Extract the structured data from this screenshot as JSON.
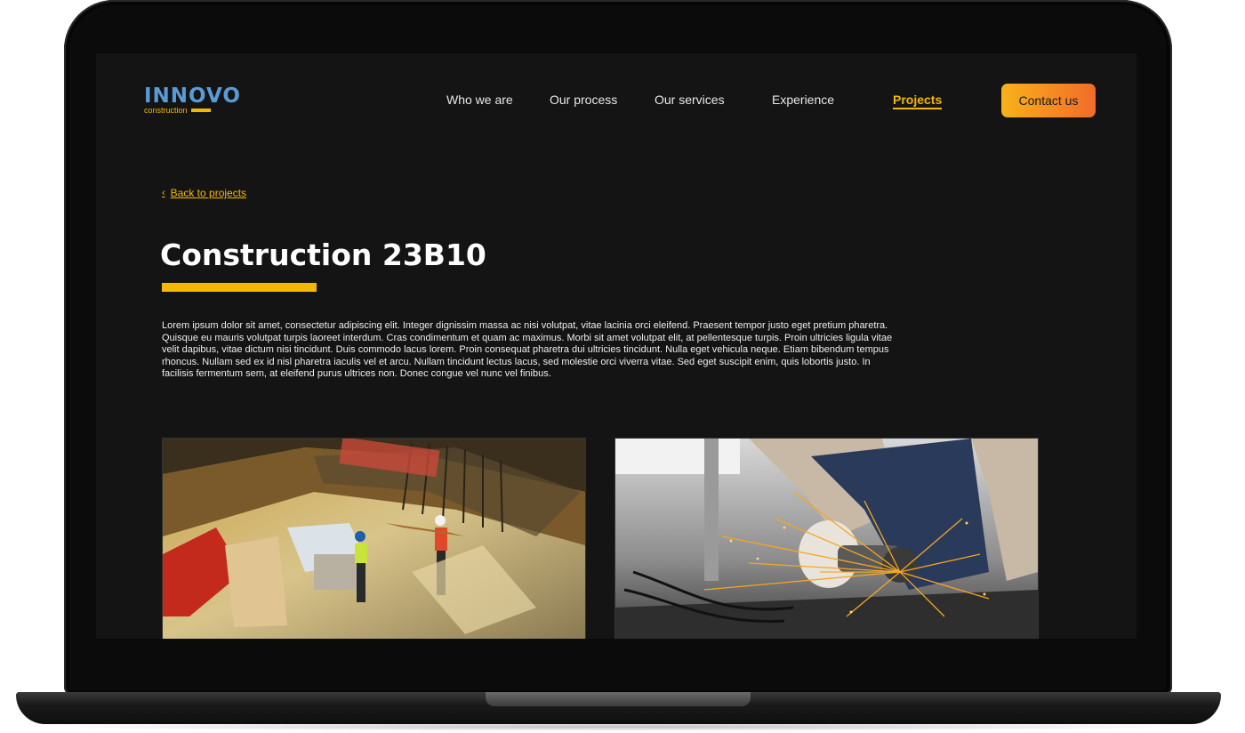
{
  "brand": {
    "name": "INNOVO",
    "tagline": "construction",
    "accent_color": "#f5b800",
    "logo_color": "#5b9bd5"
  },
  "nav": {
    "items": [
      {
        "label": "Who we are"
      },
      {
        "label": "Our process"
      },
      {
        "label": "Our services"
      },
      {
        "label": "Experience"
      },
      {
        "label": "Projects",
        "active": true
      }
    ],
    "cta_label": "Contact us"
  },
  "page": {
    "back_label": "Back to projects",
    "title": "Construction 23B10",
    "description": "Lorem ipsum dolor sit amet, consectetur adipiscing elit. Integer dignissim massa ac nisi volutpat, vitae lacinia orci eleifend. Praesent tempor justo eget pretium pharetra. Quisque eu mauris volutpat turpis laoreet interdum. Cras condimentum et quam ac maximus. Morbi sit amet volutpat elit, at pellentesque turpis. Proin ultricies ligula vitae velit dapibus, vitae dictum nisi tincidunt. Duis commodo lacus lorem. Proin consequat pharetra dui ultricies tincidunt. Nulla eget vehicula neque. Etiam bibendum tempus rhoncus. Nullam sed ex id nisl pharetra iaculis vel et arcu. Nullam tincidunt lectus lacus, sed molestie orci viverra vitae. Sed eget suscipit enim, quis lobortis justo. In facilisis fermentum sem, at eleifend purus ultrices non. Donec congue vel nunc vel finibus."
  },
  "gallery": [
    {
      "subject": "construction-site-workers-photo"
    },
    {
      "subject": "angle-grinder-sparks-photo"
    }
  ]
}
